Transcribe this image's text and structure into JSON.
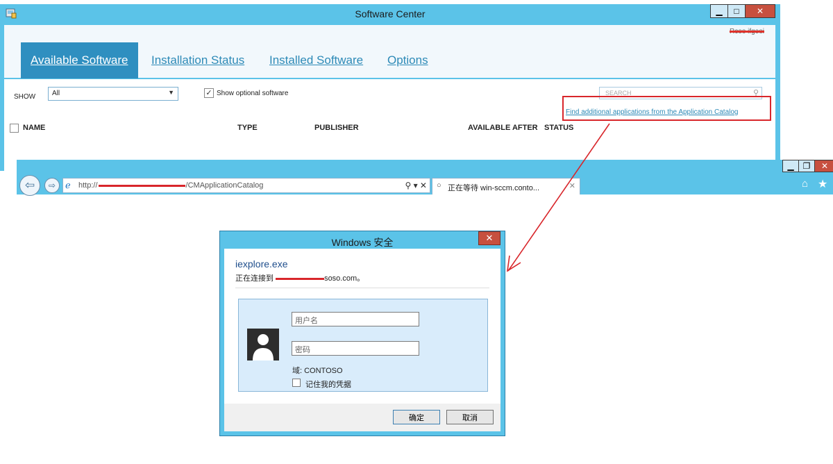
{
  "software_center": {
    "title": "Software Center",
    "user": "Rcoo ifgeoi",
    "tabs": [
      {
        "label": "Available Software",
        "active": true
      },
      {
        "label": "Installation Status",
        "active": false
      },
      {
        "label": "Installed Software",
        "active": false
      },
      {
        "label": "Options",
        "active": false
      }
    ],
    "show_label": "SHOW",
    "show_value": "All",
    "optional_checked": true,
    "optional_label": "Show optional software",
    "search_placeholder": "SEARCH",
    "catalog_link": "Find additional applications from the Application Catalog",
    "columns": [
      "NAME",
      "TYPE",
      "PUBLISHER",
      "AVAILABLE AFTER",
      "STATUS"
    ]
  },
  "browser": {
    "url_prefix": "http://",
    "url_suffix": "/CMApplicationCatalog",
    "tab_title": "正在等待 win-sccm.conto...",
    "address_controls": "⚲ ▾ ✕"
  },
  "security_dialog": {
    "title": "Windows 安全",
    "app_name": "iexplore.exe",
    "connecting_prefix": "正在连接到 ",
    "connecting_suffix": "soso.com。",
    "username_placeholder": "用户名",
    "password_placeholder": "密码",
    "domain": "域: CONTOSO",
    "remember_label": "记住我的凭据",
    "ok_label": "确定",
    "cancel_label": "取消"
  },
  "colors": {
    "window_frame": "#5bc3e8",
    "accent_tab": "#2f8fc0",
    "link": "#2d8ab7",
    "annotation_red": "#d8262b",
    "close_red": "#c7503f"
  }
}
